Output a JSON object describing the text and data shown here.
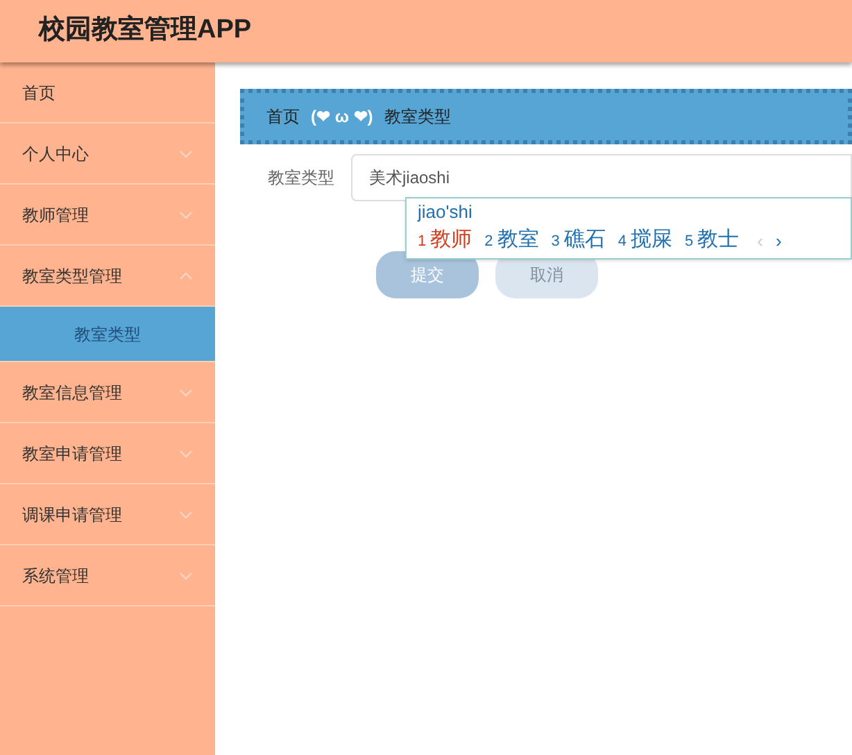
{
  "header": {
    "title": "校园教室管理APP"
  },
  "sidebar": {
    "items": [
      {
        "label": "首页",
        "kind": "link"
      },
      {
        "label": "个人中心",
        "kind": "menu",
        "expanded": false
      },
      {
        "label": "教师管理",
        "kind": "menu",
        "expanded": false
      },
      {
        "label": "教室类型管理",
        "kind": "menu",
        "expanded": true,
        "children": [
          {
            "label": "教室类型",
            "selected": true
          }
        ]
      },
      {
        "label": "教室信息管理",
        "kind": "menu",
        "expanded": false
      },
      {
        "label": "教室申请管理",
        "kind": "menu",
        "expanded": false
      },
      {
        "label": "调课申请管理",
        "kind": "menu",
        "expanded": false
      },
      {
        "label": "系统管理",
        "kind": "menu",
        "expanded": false
      }
    ]
  },
  "breadcrumb": {
    "home": "首页",
    "separator": "(❤ ω ❤)",
    "current": "教室类型"
  },
  "form": {
    "label": "教室类型",
    "value": "美术jiaoshi"
  },
  "ime": {
    "composition": "jiao'shi",
    "candidates": [
      {
        "index": "1",
        "text": "教师",
        "selected": true
      },
      {
        "index": "2",
        "text": "教室",
        "selected": false
      },
      {
        "index": "3",
        "text": "礁石",
        "selected": false
      },
      {
        "index": "4",
        "text": "搅屎",
        "selected": false
      },
      {
        "index": "5",
        "text": "教士",
        "selected": false
      }
    ],
    "prev": {
      "label": "‹",
      "disabled": true
    },
    "next": {
      "label": "›",
      "disabled": false
    }
  },
  "buttons": [
    {
      "label": "提交",
      "kind": "primary"
    },
    {
      "label": "取消",
      "kind": "secondary"
    }
  ]
}
